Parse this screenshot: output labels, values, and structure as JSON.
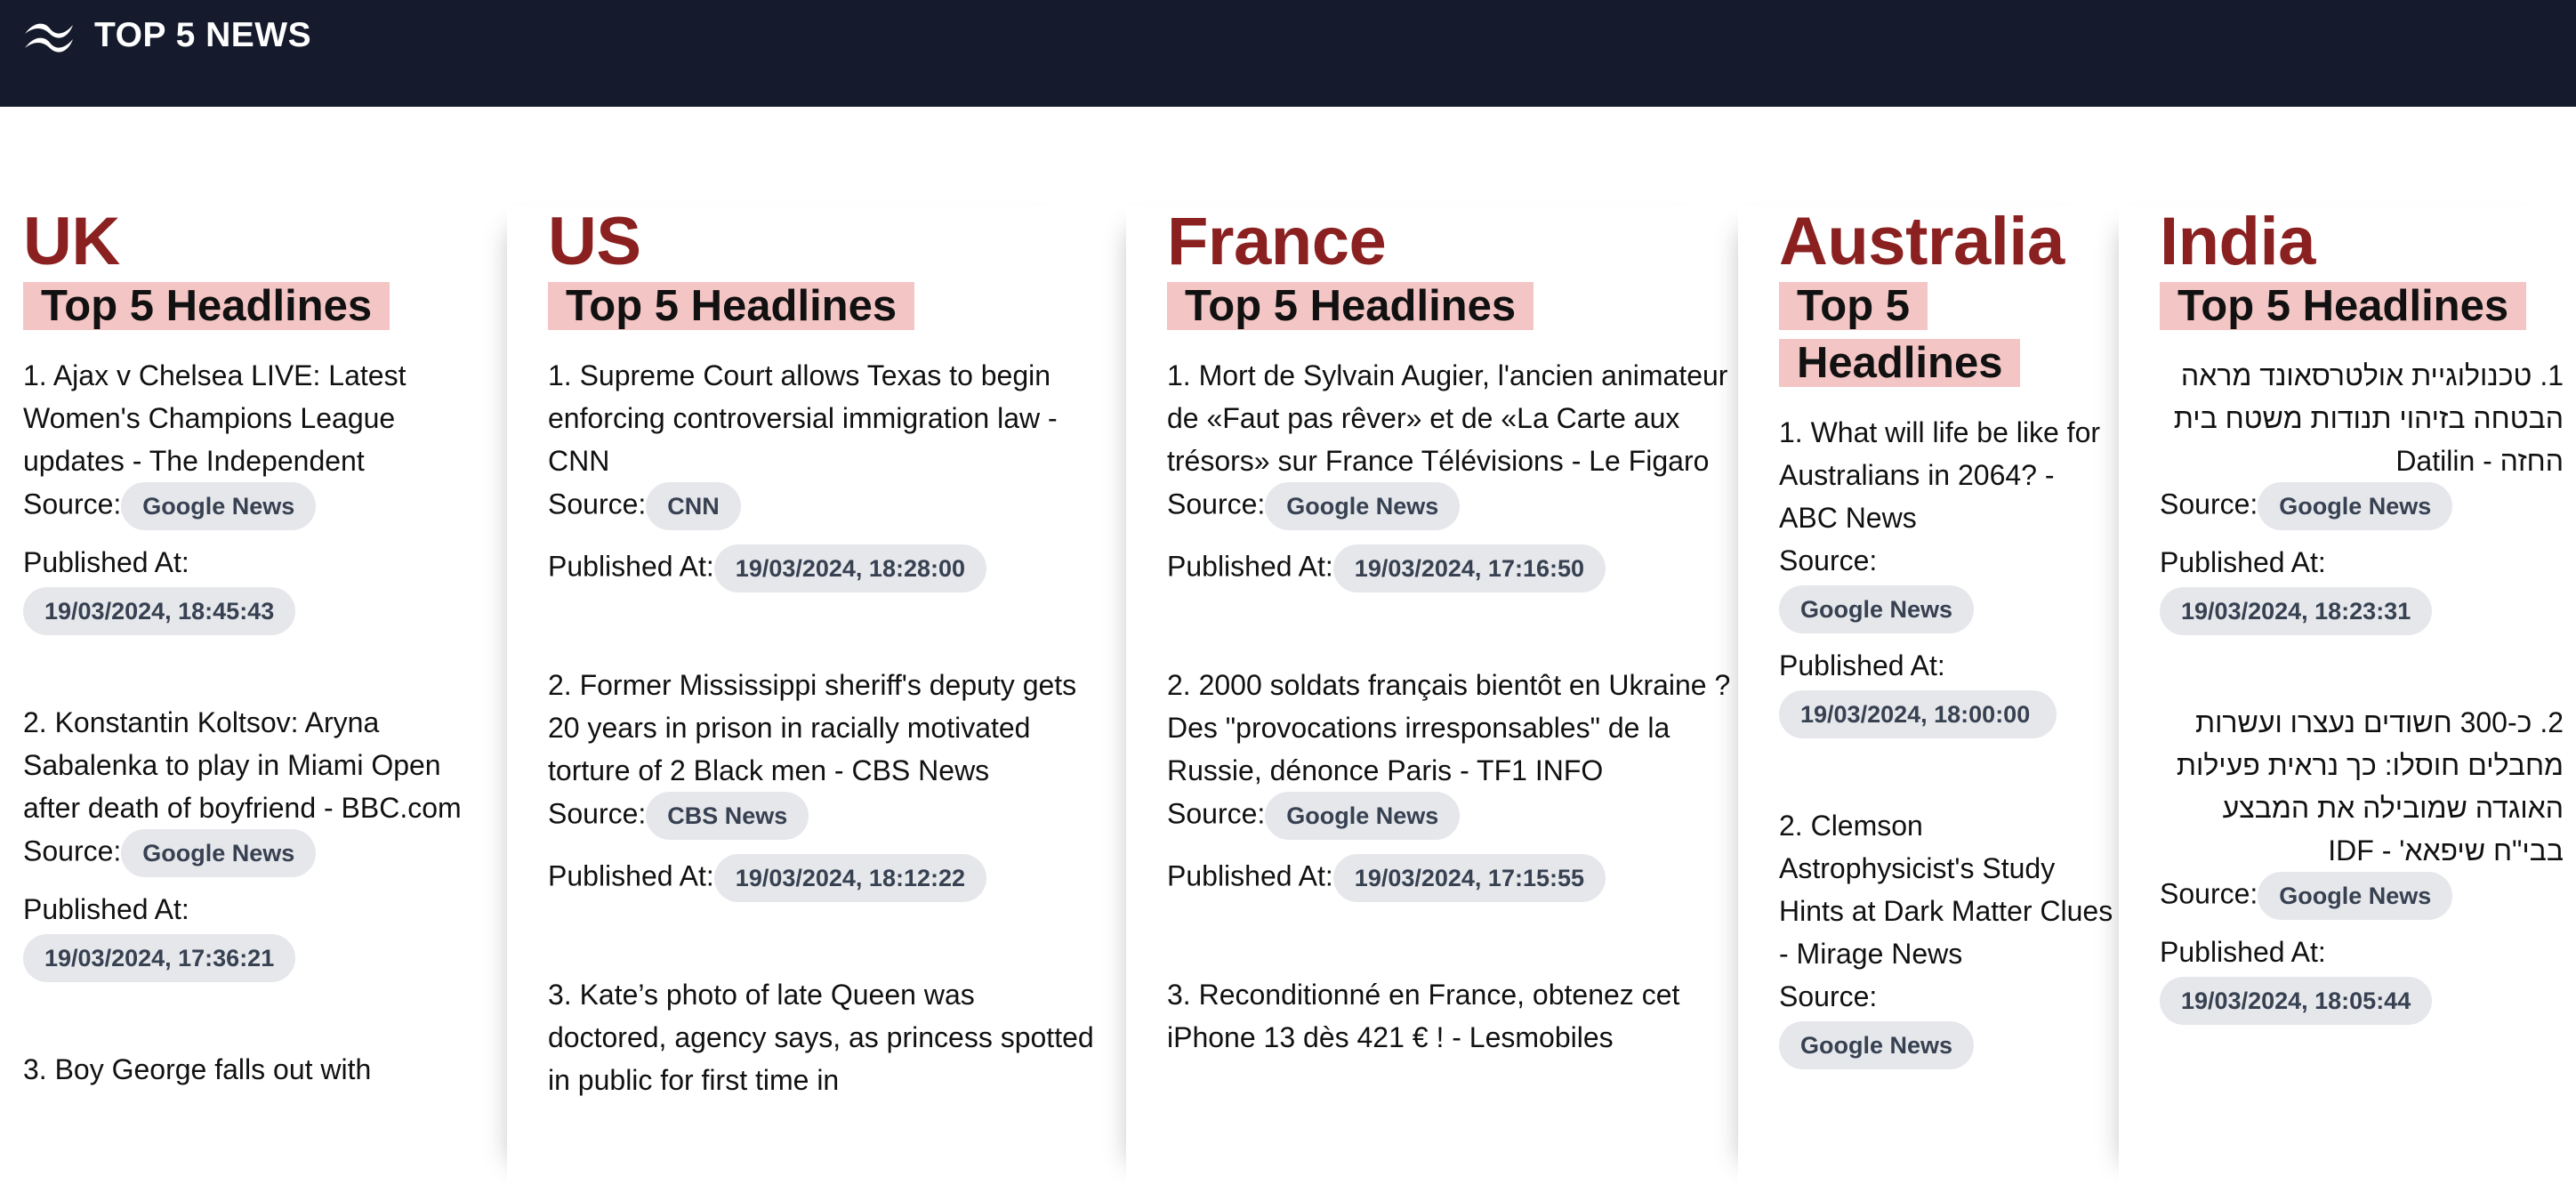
{
  "app": {
    "title": "TOP 5 NEWS",
    "logo_icon": "wave-logo-icon"
  },
  "labels": {
    "source": "Source:",
    "published": "Published At:"
  },
  "columns": [
    {
      "country": "UK",
      "subtitle": "Top 5 Headlines",
      "articles": [
        {
          "title": "1. Ajax v Chelsea LIVE: Latest Women's Champions League updates - The Independent",
          "source": "Google News",
          "published": "19/03/2024, 18:45:43"
        },
        {
          "title": "2. Konstantin Koltsov: Aryna Sabalenka to play in Miami Open after death of boyfriend - BBC.com",
          "source": "Google News",
          "published": "19/03/2024, 17:36:21"
        },
        {
          "title": "3. Boy George falls out with"
        }
      ]
    },
    {
      "country": "US",
      "subtitle": "Top 5 Headlines",
      "articles": [
        {
          "title": "1. Supreme Court allows Texas to begin enforcing controversial immigration law - CNN",
          "source": "CNN",
          "published": "19/03/2024, 18:28:00"
        },
        {
          "title": "2. Former Mississippi sheriff's deputy gets 20 years in prison in racially motivated torture of 2 Black men - CBS News",
          "source": "CBS News",
          "published": "19/03/2024, 18:12:22"
        },
        {
          "title": "3. Kate’s photo of late Queen was doctored, agency says, as princess spotted in public for first time in"
        }
      ]
    },
    {
      "country": "France",
      "subtitle": "Top 5 Headlines",
      "articles": [
        {
          "title": "1. Mort de Sylvain Augier, l'ancien animateur de «Faut pas rêver» et de «La Carte aux trésors» sur France Télévisions - Le Figaro",
          "source": "Google News",
          "published": "19/03/2024, 17:16:50"
        },
        {
          "title": "2. 2000 soldats français bientôt en Ukraine ? Des \"provocations irresponsables\" de la Russie, dénonce Paris - TF1 INFO",
          "source": "Google News",
          "published": "19/03/2024, 17:15:55"
        },
        {
          "title": "3. Reconditionné en France, obtenez cet iPhone 13 dès 421 € ! - Lesmobiles"
        }
      ]
    },
    {
      "country": "Australia",
      "subtitle": "Top 5 Headlines",
      "articles": [
        {
          "title": "1. What will life be like for Australians in 2064? - ABC News",
          "source": "Google News",
          "published": "19/03/2024, 18:00:00"
        },
        {
          "title": "2. Clemson Astrophysicist's Study Hints at Dark Matter Clues - Mirage News",
          "source": "Google News"
        }
      ]
    },
    {
      "country": "India",
      "subtitle": "Top 5 Headlines",
      "articles": [
        {
          "title": "1. טכנולוגיית אולטרסאונד מראה הבטחה בזיהוי תנודות משטח בית החזה - Datilin",
          "source": "Google News",
          "published": "19/03/2024, 18:23:31"
        },
        {
          "title": "2. כ-300 חשודים נעצרו ועשרות מחבלים חוסלו: כך נראית פעילות האוגדה שמובילה את המבצע בבי\"ח שיפאא' - IDF",
          "source": "Google News",
          "published": "19/03/2024, 18:05:44"
        }
      ]
    }
  ]
}
